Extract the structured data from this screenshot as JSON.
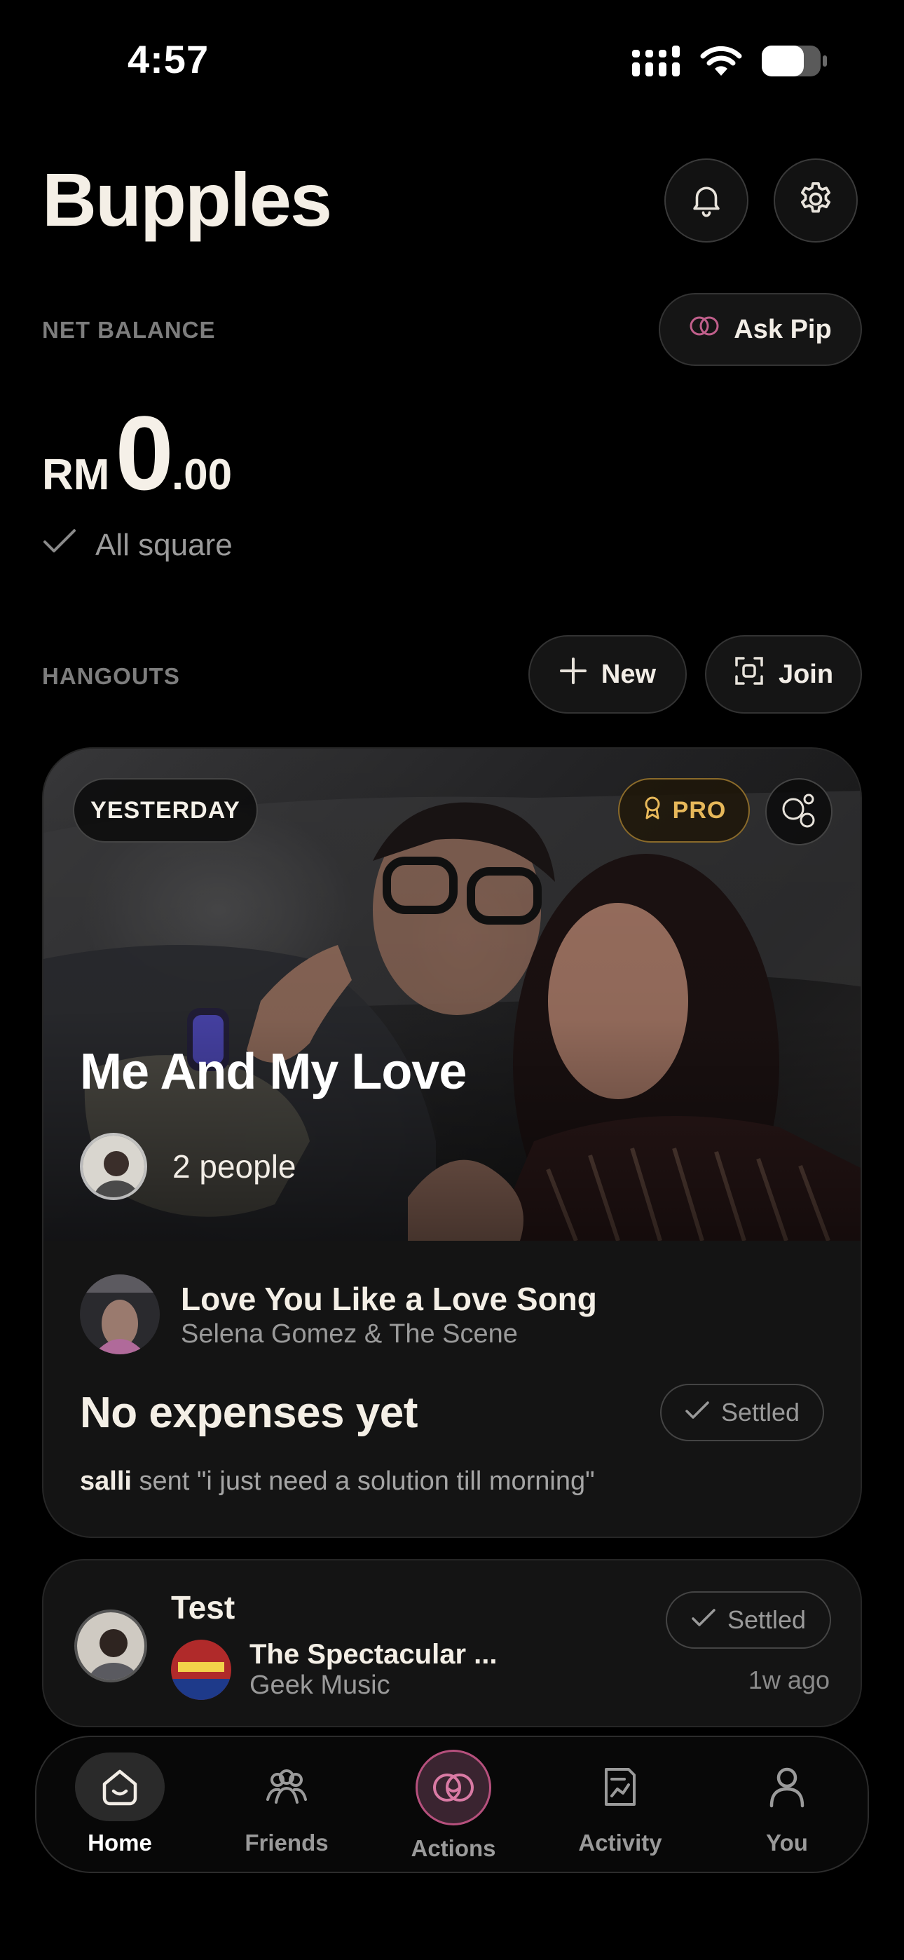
{
  "status_bar": {
    "time": "4:57"
  },
  "header": {
    "title": "Bupples"
  },
  "balance": {
    "label": "NET BALANCE",
    "ask_pip_label": "Ask Pip",
    "currency": "RM",
    "amount_int": "0",
    "amount_dec": ".00",
    "status": "All square"
  },
  "hangouts": {
    "label": "HANGOUTS",
    "new_label": "New",
    "join_label": "Join",
    "items": [
      {
        "date_tag": "YESTERDAY",
        "pro_tag": "PRO",
        "title": "Me And My Love",
        "people": "2 people",
        "song_title": "Love You Like a Love Song",
        "song_artist": "Selena Gomez & The Scene",
        "expenses": "No expenses yet",
        "settled_label": "Settled",
        "last_sender": "salli",
        "last_message": " sent \"i just need a solution till morning\""
      },
      {
        "title": "Test",
        "song_title": "The Spectacular ...",
        "song_artist": "Geek Music",
        "settled_label": "Settled",
        "time_ago": "1w ago"
      }
    ]
  },
  "tab_bar": {
    "tabs": [
      {
        "label": "Home",
        "icon": "home-icon",
        "active": true
      },
      {
        "label": "Friends",
        "icon": "friends-icon",
        "active": false
      },
      {
        "label": "Actions",
        "icon": "actions-icon",
        "active": false
      },
      {
        "label": "Activity",
        "icon": "activity-icon",
        "active": false
      },
      {
        "label": "You",
        "icon": "profile-icon",
        "active": false
      }
    ]
  },
  "colors": {
    "accent_pink": "#b6507d",
    "pro_gold": "#e7b85a",
    "background": "#000000"
  }
}
